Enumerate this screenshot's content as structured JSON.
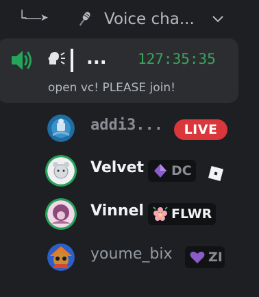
{
  "channel": {
    "prefix": "└‒‒➤",
    "name": "Voice cha...",
    "mic_icon": "microphone-icon",
    "expand_icon": "chevron-down-icon"
  },
  "active_call": {
    "speaker_icon": "speaker-volume-icon",
    "speaking_head_icon": "speaking-head-icon",
    "caller_name": "...",
    "timer": "127:35:35",
    "status": "open vc! PLEASE join!",
    "speaker_color": "#23a55a"
  },
  "users": [
    {
      "name": "addi3...",
      "badge": "LIVE",
      "name_color": "#949ba4"
    },
    {
      "name": "Velvet",
      "tag": "DC",
      "tag_icon": "purple-gem-icon",
      "extra_icon": "roblox-icon",
      "name_color": "#f2f3f5",
      "speaking": true
    },
    {
      "name": "Vinnel",
      "tag": "FLWR",
      "tag_icon": "flower-icon",
      "name_color": "#f2f3f5",
      "speaking": true
    },
    {
      "name": "youme_bix",
      "tag": "ZI",
      "tag_icon": "purple-heart-icon",
      "name_color": "#949ba4"
    }
  ],
  "colors": {
    "live_badge": "#da373c",
    "timer": "#3ba55c",
    "speaking_ring": "#23a55a"
  }
}
